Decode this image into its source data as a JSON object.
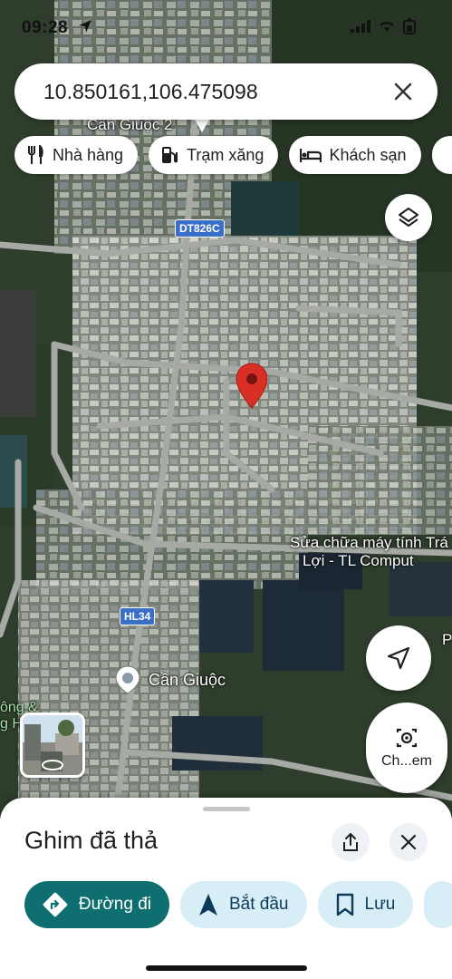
{
  "status_bar": {
    "time": "09:28"
  },
  "search": {
    "value": "10.850161,106.475098"
  },
  "chips": [
    {
      "label": "Nhà hàng",
      "icon": "restaurant-icon"
    },
    {
      "label": "Trạm xăng",
      "icon": "gas-station-icon"
    },
    {
      "label": "Khách sạn",
      "icon": "hotel-icon"
    }
  ],
  "map": {
    "labels": {
      "place_top": "Cần Giuộc 2",
      "road_dt": "DT826C",
      "road_hl": "HL34",
      "poi_computer_line1": "Sửa chữa máy tính Trá",
      "poi_computer_line2": "Lợi - TL Comput",
      "town": "Cần Giuộc",
      "left_cut1": "ông &",
      "left_cut2": "g H",
      "right_cut": "P"
    },
    "pin_color": "#d93025"
  },
  "camera_button": {
    "label": "Ch...em"
  },
  "sheet": {
    "title": "Ghim đã thả",
    "actions": [
      {
        "label": "Đường đi",
        "icon": "directions-icon"
      },
      {
        "label": "Bắt đầu",
        "icon": "navigation-arrow-icon"
      },
      {
        "label": "Lưu",
        "icon": "bookmark-icon"
      }
    ]
  },
  "colors": {
    "accent": "#0e6e70",
    "secondary_button": "#d7eef7",
    "road_shield": "#3a6fc9"
  }
}
